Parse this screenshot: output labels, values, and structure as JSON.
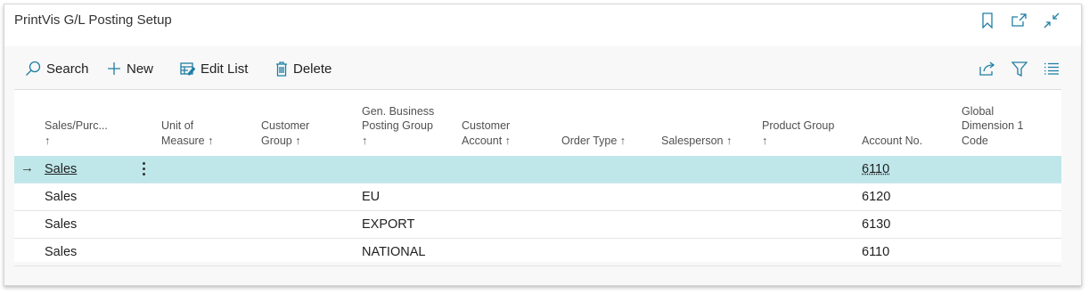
{
  "page": {
    "title": "PrintVis G/L Posting Setup"
  },
  "top_actions": [
    "bookmark-icon",
    "open-new-window-icon",
    "collapse-icon"
  ],
  "actionbar": {
    "search": "Search",
    "new": "New",
    "edit_list": "Edit List",
    "delete": "Delete"
  },
  "right_actions": [
    "share-icon",
    "filter-icon",
    "list-view-icon"
  ],
  "columns": {
    "c1": {
      "l1": "Sales/Purc...",
      "l2": "↑"
    },
    "c2": {
      "l1": "Unit of",
      "l2": "Measure ↑"
    },
    "c3": {
      "l1": "Customer",
      "l2": "Group ↑"
    },
    "c4": {
      "l1": "Gen. Business",
      "l2": "Posting Group",
      "l3": "↑"
    },
    "c5": {
      "l1": "Customer",
      "l2": "Account ↑"
    },
    "c6": {
      "l1": "Order Type ↑"
    },
    "c7": {
      "l1": "Salesperson ↑"
    },
    "c8": {
      "l1": "Product Group",
      "l2": "↑"
    },
    "c9": {
      "l1": "Account No."
    },
    "c10": {
      "l1": "Global",
      "l2": "Dimension 1",
      "l3": "Code"
    }
  },
  "rows": [
    {
      "type": "Sales",
      "gen_bus": "",
      "account": "6110",
      "selected": true
    },
    {
      "type": "Sales",
      "gen_bus": "EU",
      "account": "6120"
    },
    {
      "type": "Sales",
      "gen_bus": "EXPORT",
      "account": "6130"
    },
    {
      "type": "Sales",
      "gen_bus": "NATIONAL",
      "account": "6110"
    }
  ],
  "row_indicator": "→",
  "colors": {
    "accent": "#1f7ea3",
    "selected_row": "#bfe7ea"
  }
}
